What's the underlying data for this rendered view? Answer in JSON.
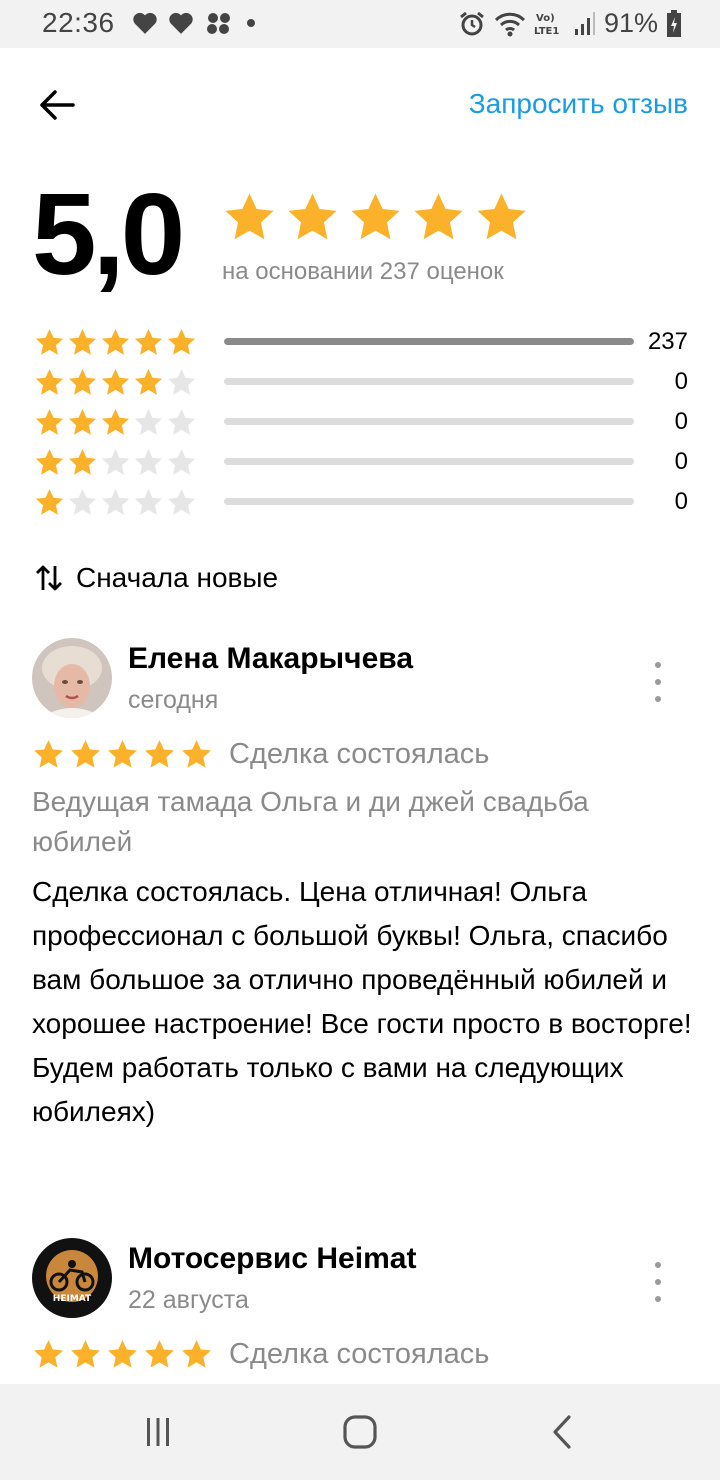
{
  "status_bar": {
    "time": "22:36",
    "battery": "91%",
    "network": "LTE1",
    "icons": [
      "heart-icon",
      "heart-icon",
      "paw-icon",
      "dot-icon",
      "alarm-icon",
      "wifi-icon",
      "signal-icon",
      "battery-icon"
    ]
  },
  "header": {
    "back_icon": "arrow-left-icon",
    "request_link": "Запросить отзыв"
  },
  "summary": {
    "score": "5,0",
    "stars": 5,
    "caption": "на основании 237 оценок"
  },
  "distribution": [
    {
      "stars": 5,
      "count": "237",
      "fraction": 1.0
    },
    {
      "stars": 4,
      "count": "0",
      "fraction": 0
    },
    {
      "stars": 3,
      "count": "0",
      "fraction": 0
    },
    {
      "stars": 2,
      "count": "0",
      "fraction": 0
    },
    {
      "stars": 1,
      "count": "0",
      "fraction": 0
    }
  ],
  "sort": {
    "icon": "sort-arrows-icon",
    "label": "Сначала новые"
  },
  "reviews": [
    {
      "author": "Елена Макарычева",
      "date": "сегодня",
      "rating": 5,
      "deal_status": "Сделка состоялась",
      "service": "Ведущая тамада Ольга и ди джей свадьба юбилей",
      "text": "Сделка состоялась. Цена отличная! Ольга профессионал с большой буквы! Ольга, спасибо  вам большое за отлично проведённый юбилей и хорошее настроение! Все гости просто в восторге! Будем работать только с вами на следующих юбилеях)"
    },
    {
      "author": "Мотосервис Heimat",
      "date": "22 августа",
      "rating": 5,
      "deal_status": "Сделка состоялась",
      "avatar_text": "HEIMAT"
    }
  ],
  "colors": {
    "star_filled": "#fbb12a",
    "star_empty": "#e6e6e6",
    "accent": "#1a9be6",
    "muted": "#8a8a8a",
    "bar_fill": "#8a8a8a",
    "bar_track": "#dcdcdc"
  },
  "nav_bar": {
    "icons": [
      "recent-apps-icon",
      "home-icon",
      "back-nav-icon"
    ]
  }
}
